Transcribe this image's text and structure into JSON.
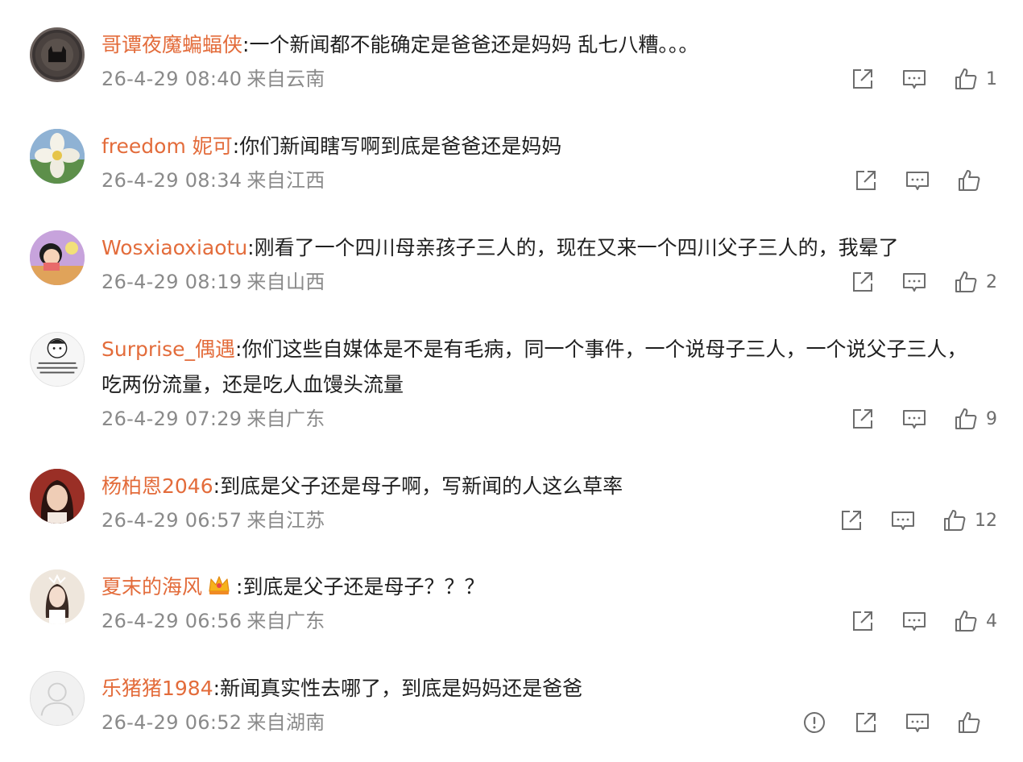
{
  "colors": {
    "username": "#e36c3b",
    "text": "#1f1f1f",
    "meta": "#8a8a8a",
    "icon": "#6d6d6d",
    "background": "#ffffff"
  },
  "comments": [
    {
      "username": "哥谭夜魔蝙蝠侠",
      "separator": ":",
      "text": "一个新闻都不能确定是爸爸还是妈妈 乱七八糟。。。",
      "time": "26-4-29 08:40",
      "location": "来自云南",
      "like_count": "1",
      "avatar_icon": "batman-avatar-icon",
      "actions": [
        "share-icon",
        "comment-icon",
        "like-icon"
      ]
    },
    {
      "username": "freedom 妮可",
      "separator": ":",
      "text": "你们新闻瞎写啊到底是爸爸还是妈妈",
      "time": "26-4-29 08:34",
      "location": "来自江西",
      "like_count": "",
      "avatar_icon": "flower-avatar-icon",
      "actions": [
        "share-icon",
        "comment-icon",
        "like-icon"
      ]
    },
    {
      "username": "Wosxiaoxiaotu",
      "separator": ":",
      "text": "刚看了一个四川母亲孩子三人的，现在又来一个四川父子三人的，我晕了",
      "time": "26-4-29 08:19",
      "location": "来自山西",
      "like_count": "2",
      "avatar_icon": "cartoon-girl-avatar-icon",
      "actions": [
        "share-icon",
        "comment-icon",
        "like-icon"
      ]
    },
    {
      "username": "Surprise_偶遇",
      "separator": ":",
      "text": "你们这些自媒体是不是有毛病，同一个事件，一个说母子三人，一个说父子三人，吃两份流量，还是吃人血馒头流量",
      "time": "26-4-29 07:29",
      "location": "来自广东",
      "like_count": "9",
      "avatar_icon": "meme-avatar-icon",
      "actions": [
        "share-icon",
        "comment-icon",
        "like-icon"
      ]
    },
    {
      "username": "杨柏恩2046",
      "separator": ":",
      "text": "到底是父子还是母子啊，写新闻的人这么草率",
      "time": "26-4-29 06:57",
      "location": "来自江苏",
      "like_count": "12",
      "avatar_icon": "woman-portrait-avatar-icon",
      "actions": [
        "share-icon",
        "comment-icon",
        "like-icon"
      ]
    },
    {
      "username": "夏末的海风",
      "badge_icon": "crown-badge-icon",
      "separator": ":",
      "text": "到底是父子还是母子？？？",
      "time": "26-4-29 06:56",
      "location": "来自广东",
      "like_count": "4",
      "avatar_icon": "girl-portrait-avatar-icon",
      "actions": [
        "share-icon",
        "comment-icon",
        "like-icon"
      ]
    },
    {
      "username": "乐猪猪1984",
      "separator": ":",
      "text": "新闻真实性去哪了，到底是妈妈还是爸爸",
      "time": "26-4-29 06:52",
      "location": "来自湖南",
      "like_count": "",
      "avatar_icon": "default-avatar-icon",
      "actions": [
        "report-icon",
        "share-icon",
        "comment-icon",
        "like-icon"
      ]
    }
  ]
}
